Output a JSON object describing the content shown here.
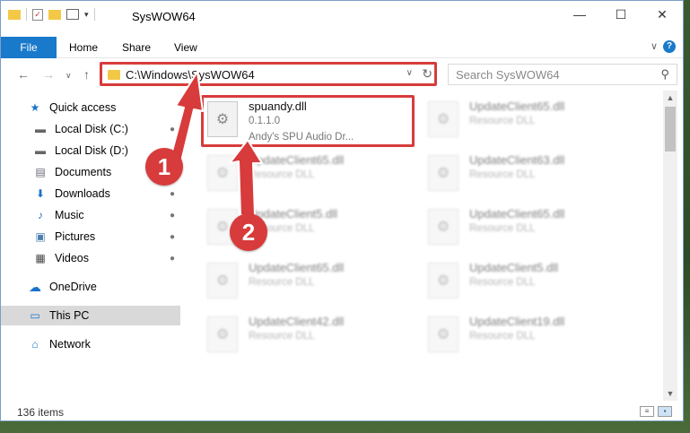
{
  "window": {
    "title": "SysWOW64",
    "controls": {
      "minimize": "—",
      "maximize": "☐",
      "close": "✕"
    }
  },
  "ribbon": {
    "file_tab": "File",
    "tabs": [
      "Home",
      "Share",
      "View"
    ],
    "expand": "∨",
    "help": "?"
  },
  "nav": {
    "back": "←",
    "forward": "→",
    "recent": "∨",
    "up": "↑",
    "address_path": "C:\\Windows\\SysWOW64",
    "address_dropdown": "∨",
    "refresh": "↻",
    "search_placeholder": "Search SysWOW64",
    "search_icon": "⚲"
  },
  "sidebar": {
    "items": [
      {
        "label": "Quick access",
        "icon": "star-icon",
        "glyph": "★",
        "pinned": false
      },
      {
        "label": "Local Disk (C:)",
        "icon": "drive-icon",
        "glyph": "▬",
        "pinned": true
      },
      {
        "label": "Local Disk (D:)",
        "icon": "drive-icon",
        "glyph": "▬",
        "pinned": true
      },
      {
        "label": "Documents",
        "icon": "documents-icon",
        "glyph": "▤",
        "pinned": true
      },
      {
        "label": "Downloads",
        "icon": "download-icon",
        "glyph": "⬇",
        "pinned": true
      },
      {
        "label": "Music",
        "icon": "music-icon",
        "glyph": "♪",
        "pinned": true
      },
      {
        "label": "Pictures",
        "icon": "pictures-icon",
        "glyph": "▣",
        "pinned": true
      },
      {
        "label": "Videos",
        "icon": "videos-icon",
        "glyph": "▦",
        "pinned": true
      },
      {
        "label": "OneDrive",
        "icon": "cloud-icon",
        "glyph": "☁",
        "pinned": false
      },
      {
        "label": "This PC",
        "icon": "computer-icon",
        "glyph": "▭",
        "pinned": false
      },
      {
        "label": "Network",
        "icon": "network-icon",
        "glyph": "⌂",
        "pinned": false
      }
    ],
    "pin_glyph": "📌"
  },
  "files": [
    {
      "name": "spuandy.dll",
      "line2": "0.1.1.0",
      "line3": "Andy's SPU Audio Dr...",
      "blurred": false
    },
    {
      "name": "UpdateClient65.dll",
      "line2": "Resource DLL",
      "blurred": true
    },
    {
      "name": "UpdateClient65.dll",
      "line2": "Resource DLL",
      "blurred": true
    },
    {
      "name": "UpdateClient63.dll",
      "line2": "Resource DLL",
      "blurred": true
    },
    {
      "name": "UpdateClient5.dll",
      "line2": "Resource DLL",
      "blurred": true
    },
    {
      "name": "UpdateClient65.dll",
      "line2": "Resource DLL",
      "blurred": true
    },
    {
      "name": "UpdateClient65.dll",
      "line2": "Resource DLL",
      "blurred": true
    },
    {
      "name": "UpdateClient5.dll",
      "line2": "Resource DLL",
      "blurred": true
    },
    {
      "name": "UpdateClient42.dll",
      "line2": "Resource DLL",
      "blurred": true
    },
    {
      "name": "UpdateClient19.dll",
      "line2": "Resource DLL",
      "blurred": true
    }
  ],
  "status": {
    "item_count": "136 items"
  },
  "annotations": {
    "step1": "1",
    "step2": "2",
    "accent": "#d83b3b"
  }
}
